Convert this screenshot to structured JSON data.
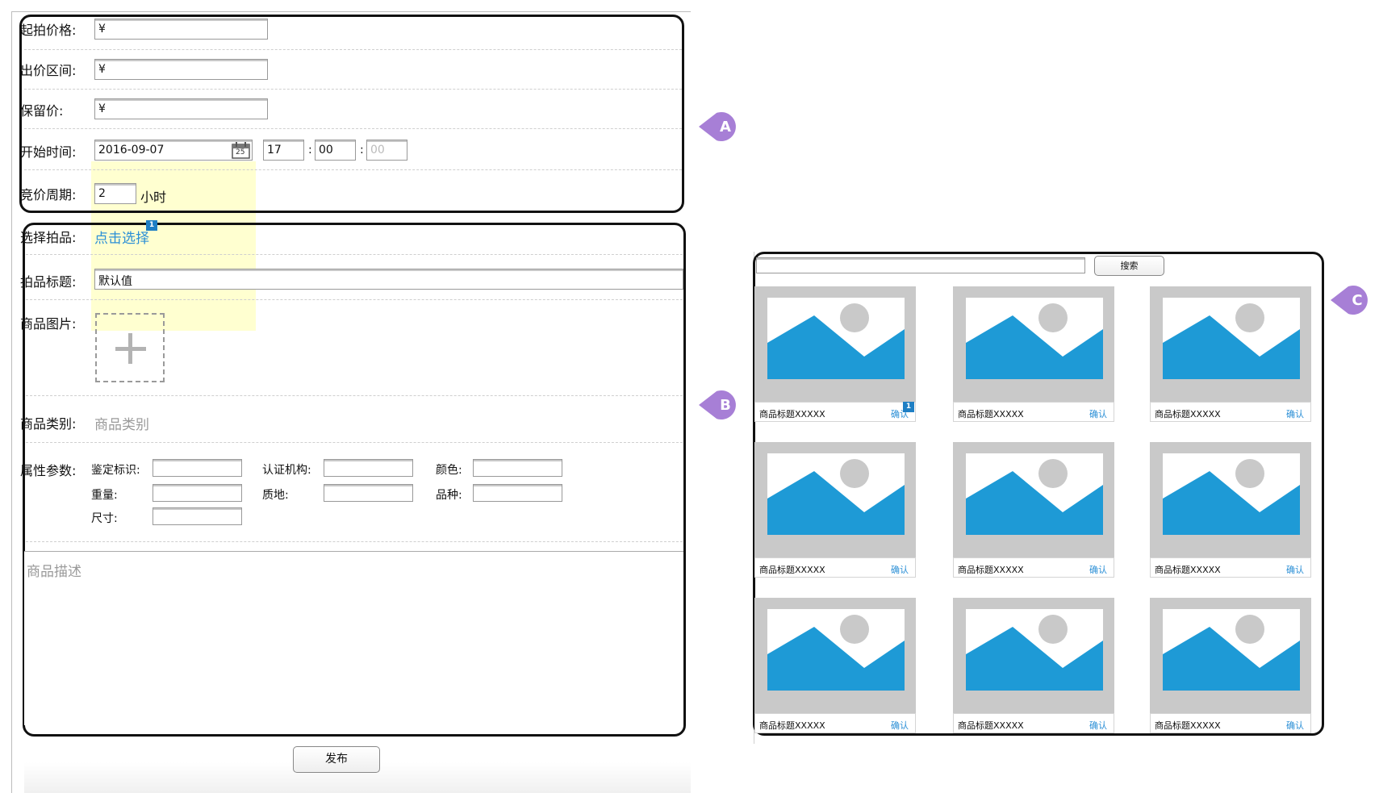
{
  "form_a": {
    "start_price_label": "起拍价格:",
    "start_price_value": "¥",
    "bid_range_label": "出价区间:",
    "bid_range_value": "¥",
    "reserve_price_label": "保留价:",
    "reserve_price_value": "¥",
    "start_time_label": "开始时间:",
    "start_date_value": "2016-09-07",
    "calendar_day": "25",
    "hour_value": "17",
    "minute_value": "00",
    "second_value": "00",
    "time_sep": ":",
    "period_label": "竞价周期:",
    "period_value": "2",
    "period_unit": "小时"
  },
  "form_b": {
    "select_item_label": "选择拍品:",
    "select_item_link": "点击选择",
    "select_item_badge": "1",
    "title_label": "拍品标题:",
    "title_value": "默认值",
    "image_label": "商品图片:",
    "category_label": "商品类别:",
    "category_placeholder": "商品类别",
    "attributes_label": "属性参数:",
    "attr": {
      "authentication": "鉴定标识:",
      "certifier": "认证机构:",
      "color": "颜色:",
      "weight": "重量:",
      "texture": "质地:",
      "variety": "品种:",
      "size": "尺寸:"
    },
    "description_placeholder": "商品描述"
  },
  "publish_button": "发布",
  "markers": {
    "a": "A",
    "b": "B",
    "c": "C"
  },
  "panel_c": {
    "search_button": "搜索",
    "cards": [
      {
        "title": "商品标题XXXXX",
        "confirm": "确认",
        "badge": "1"
      },
      {
        "title": "商品标题XXXXX",
        "confirm": "确认"
      },
      {
        "title": "商品标题XXXXX",
        "confirm": "确认"
      },
      {
        "title": "商品标题XXXXX",
        "confirm": "确认"
      },
      {
        "title": "商品标题XXXXX",
        "confirm": "确认"
      },
      {
        "title": "商品标题XXXXX",
        "confirm": "确认"
      },
      {
        "title": "商品标题XXXXX",
        "confirm": "确认"
      },
      {
        "title": "商品标题XXXXX",
        "confirm": "确认"
      },
      {
        "title": "商品标题XXXXX",
        "confirm": "确认"
      }
    ]
  },
  "colors": {
    "marker": "#a77fd6",
    "link": "#2b8fd6",
    "image_sky": "#ffffff",
    "image_mountain": "#1e9ad6",
    "image_frame": "#c9c9c9",
    "highlight": "#ffffaa"
  }
}
